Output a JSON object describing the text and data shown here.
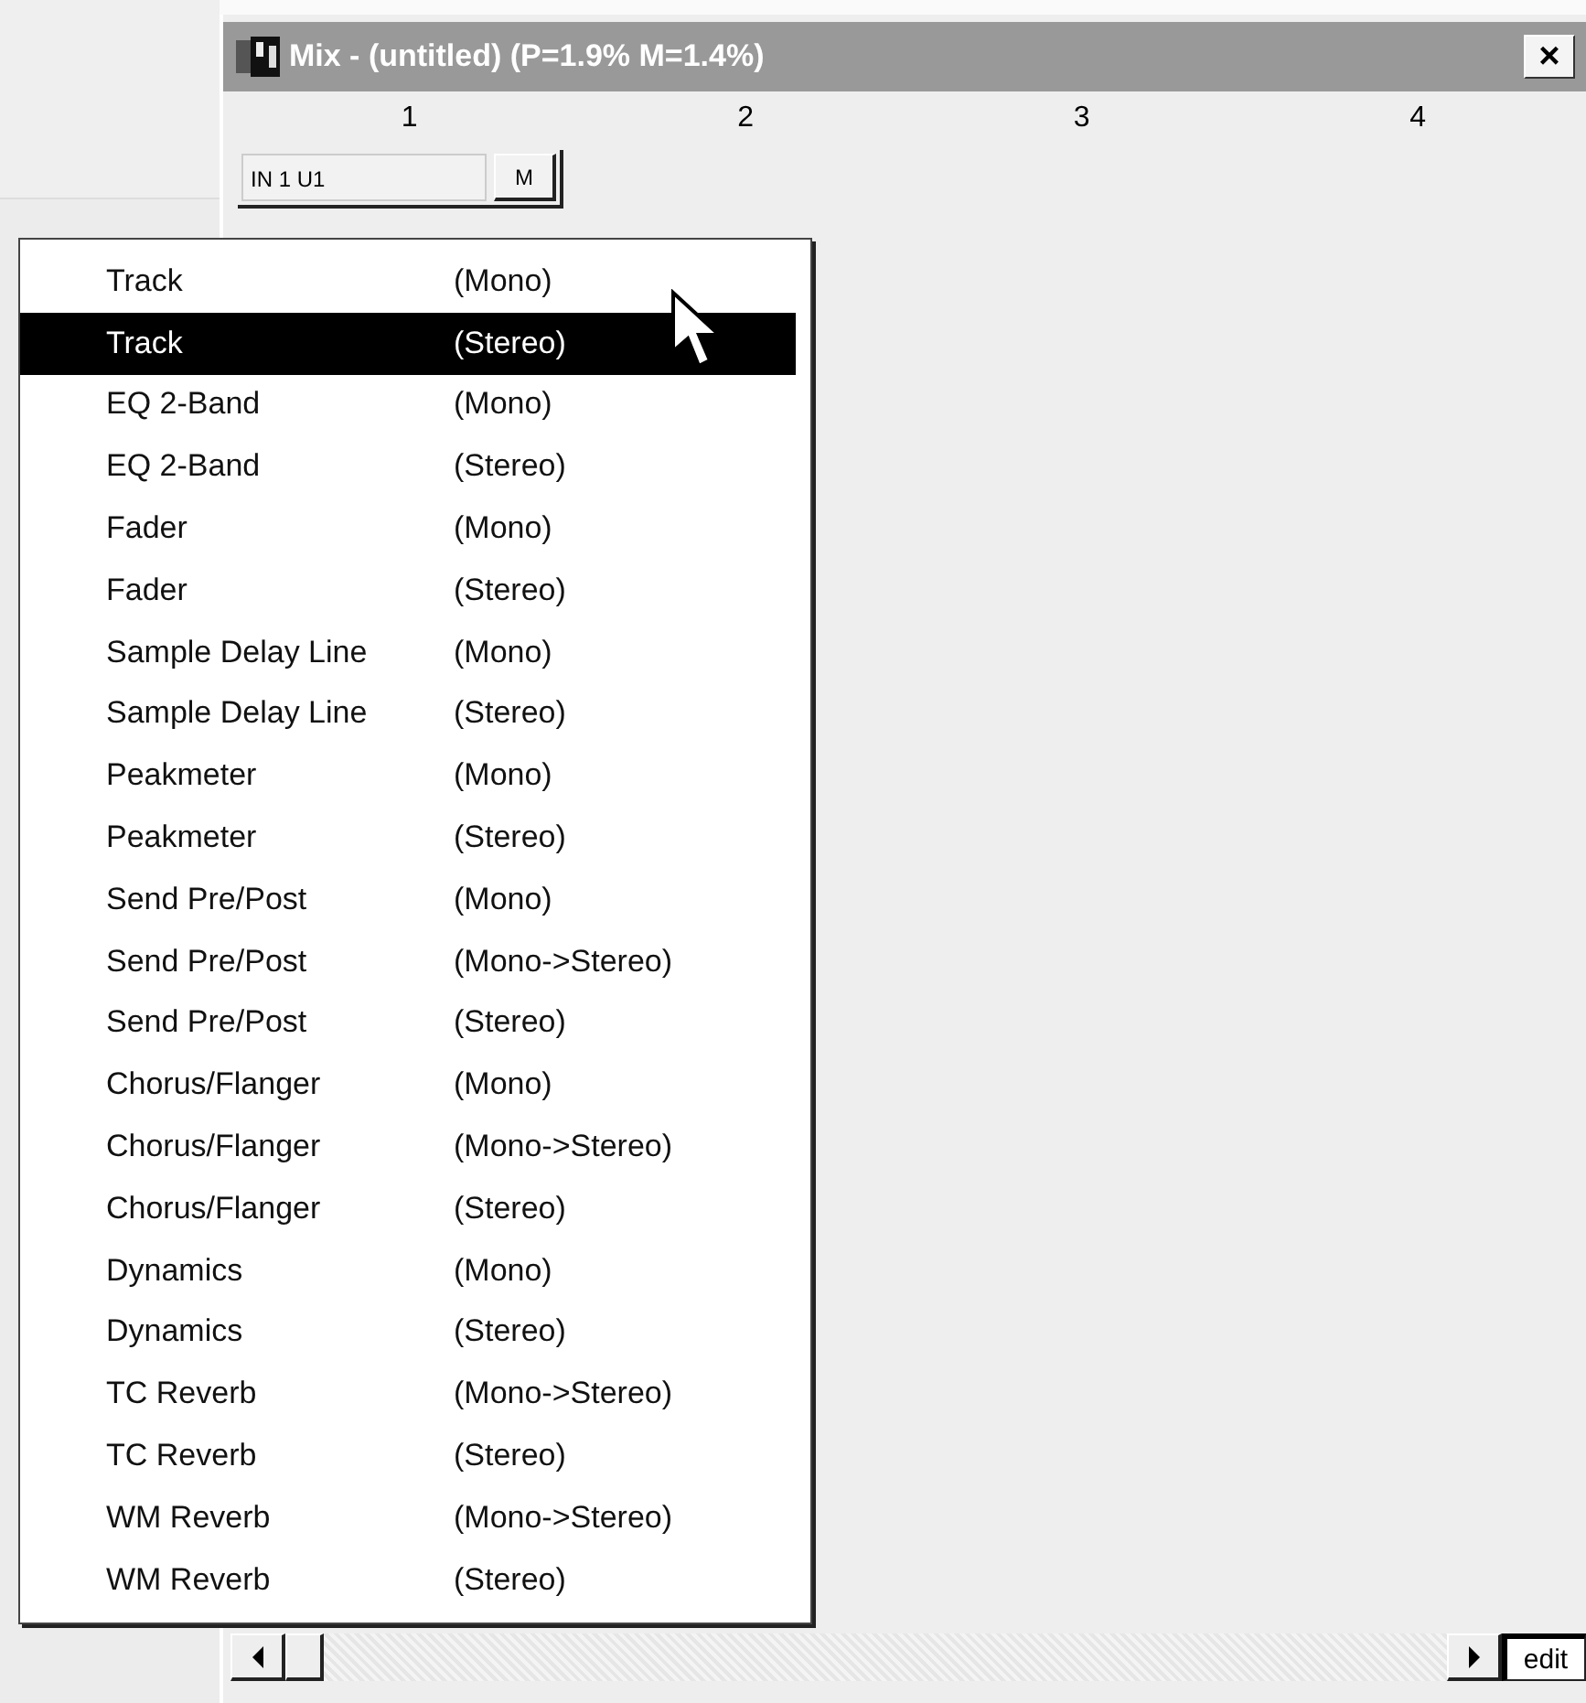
{
  "window": {
    "title": "Mix - (untitled) (P=1.9% M=1.4%)",
    "close": "×"
  },
  "columns": [
    "1",
    "2",
    "3",
    "4"
  ],
  "strip": {
    "name": "IN 1 U1",
    "button": "M"
  },
  "menu": [
    {
      "name": "Track",
      "mode": "(Mono)",
      "selected": false
    },
    {
      "name": "Track",
      "mode": "(Stereo)",
      "selected": true
    },
    {
      "name": "EQ 2-Band",
      "mode": "(Mono)",
      "selected": false
    },
    {
      "name": "EQ 2-Band",
      "mode": "(Stereo)",
      "selected": false
    },
    {
      "name": "Fader",
      "mode": "(Mono)",
      "selected": false
    },
    {
      "name": "Fader",
      "mode": "(Stereo)",
      "selected": false
    },
    {
      "name": "Sample Delay Line",
      "mode": "(Mono)",
      "selected": false
    },
    {
      "name": "Sample Delay Line",
      "mode": "(Stereo)",
      "selected": false
    },
    {
      "name": "Peakmeter",
      "mode": "(Mono)",
      "selected": false
    },
    {
      "name": "Peakmeter",
      "mode": "(Stereo)",
      "selected": false
    },
    {
      "name": "Send Pre/Post",
      "mode": "(Mono)",
      "selected": false
    },
    {
      "name": "Send Pre/Post",
      "mode": "(Mono->Stereo)",
      "selected": false
    },
    {
      "name": "Send Pre/Post",
      "mode": "(Stereo)",
      "selected": false
    },
    {
      "name": "Chorus/Flanger",
      "mode": "(Mono)",
      "selected": false
    },
    {
      "name": "Chorus/Flanger",
      "mode": "(Mono->Stereo)",
      "selected": false
    },
    {
      "name": "Chorus/Flanger",
      "mode": "(Stereo)",
      "selected": false
    },
    {
      "name": "Dynamics",
      "mode": "(Mono)",
      "selected": false
    },
    {
      "name": "Dynamics",
      "mode": "(Stereo)",
      "selected": false
    },
    {
      "name": "TC Reverb",
      "mode": "(Mono->Stereo)",
      "selected": false
    },
    {
      "name": "TC Reverb",
      "mode": "(Stereo)",
      "selected": false
    },
    {
      "name": "WM Reverb",
      "mode": "(Mono->Stereo)",
      "selected": false
    },
    {
      "name": "WM Reverb",
      "mode": "(Stereo)",
      "selected": false
    }
  ],
  "edit_button": "edit"
}
